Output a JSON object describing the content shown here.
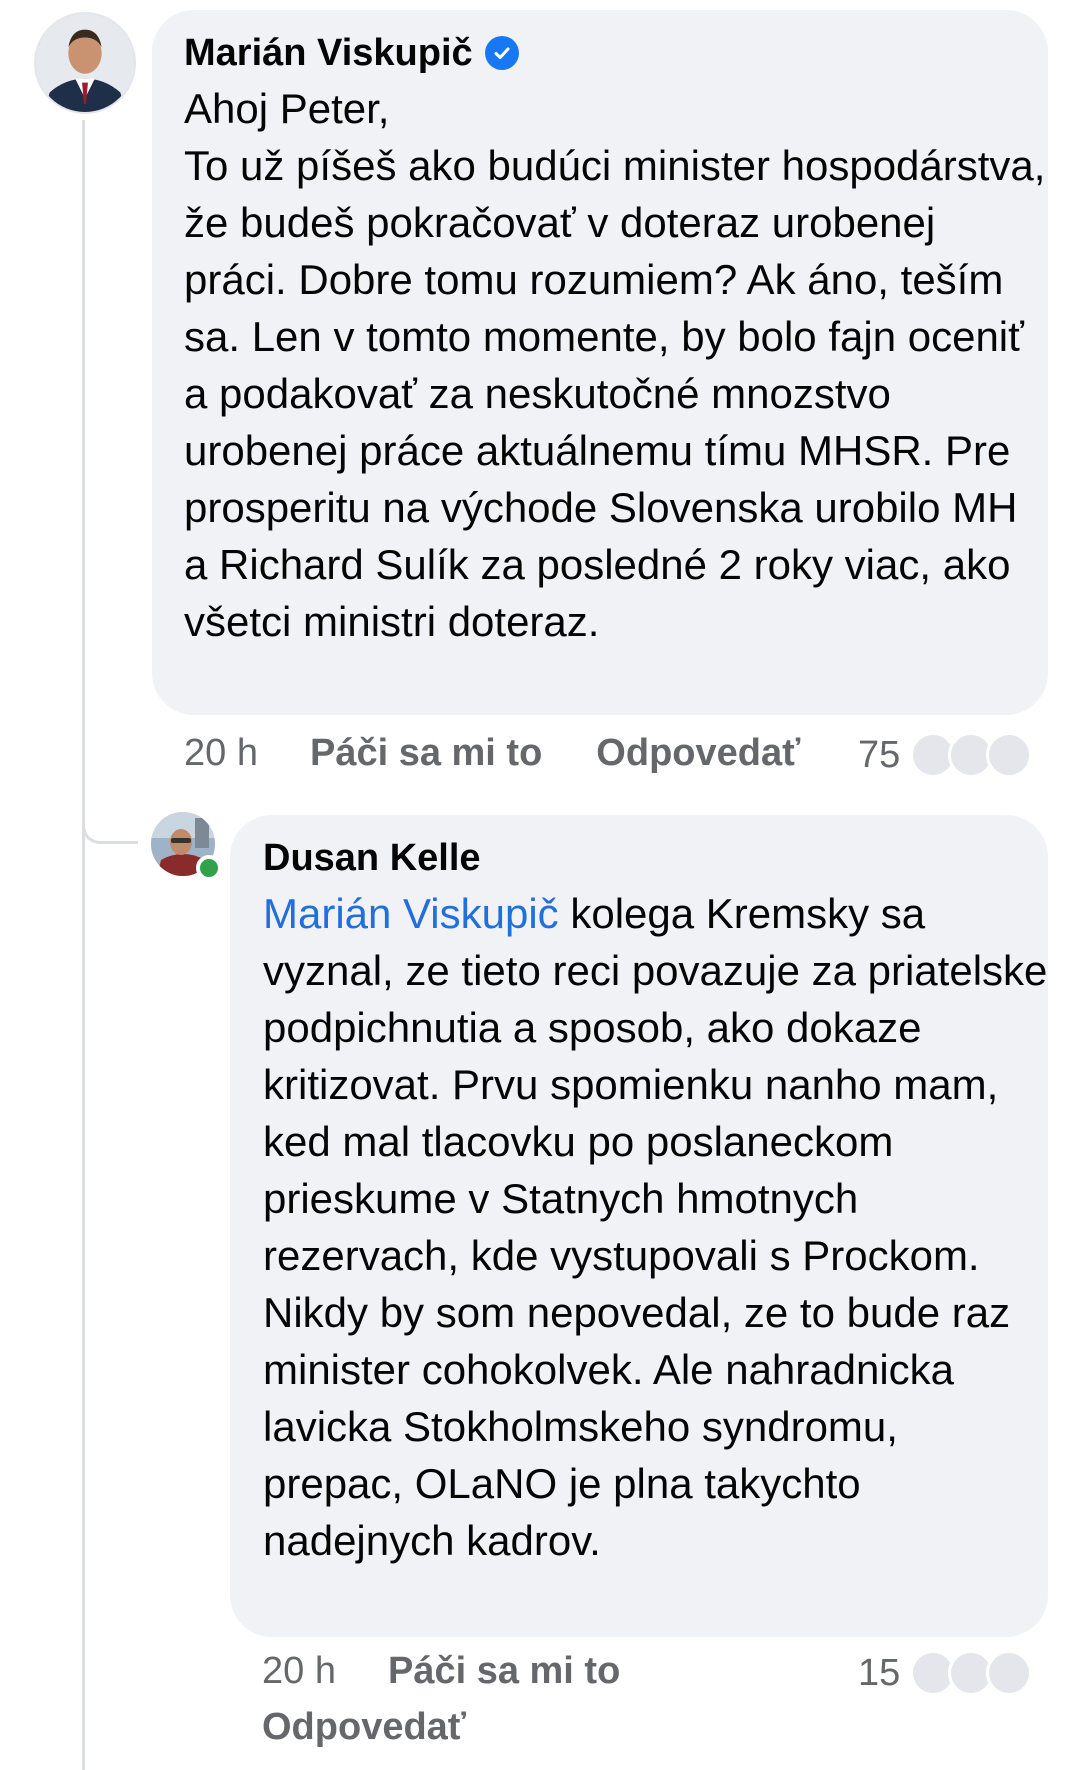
{
  "comment": {
    "author": "Marián Viskupič",
    "text": "Ahoj Peter,\nTo už píšeš ako budúci minister hospodárstva, že budeš pokračovať v doteraz urobenej práci. Dobre tomu rozumiem? Ak áno, teším sa. Len v tomto momente, by bolo fajn oceniť a podakovať za neskutočné mnozstvo urobenej práce aktuálnemu tímu MHSR. Pre prosperitu na východe Slovenska urobilo MH a Richard Sulík za posledné 2 roky viac, ako všetci ministri doteraz.",
    "time": "20 h",
    "like_label": "Páči sa mi to",
    "reply_label": "Odpovedať",
    "reaction_count": "75"
  },
  "reply": {
    "author": "Dusan Kelle",
    "mention": "Marián Viskupič",
    "text": " kolega Kremsky sa vyznal, ze tieto reci povazuje za priatelske podpichnutia a sposob, ako dokaze kritizovat. Prvu spomienku nanho mam, ked mal tlacovku po poslaneckom prieskume v Statnych hmotnych rezervach, kde vystupovali s Prockom. Nikdy by som nepovedal, ze to bude raz minister cohokolvek. Ale nahradnicka lavicka Stokholmskeho syndromu, prepac, OLaNO je plna takychto nadejnych kadrov.",
    "time": "20 h",
    "like_label": "Páči sa mi to",
    "reply_label": "Odpovedať",
    "reaction_count": "15"
  },
  "colors": {
    "bubble": "#f0f2f5",
    "mention": "#216fdb",
    "verified": "#1877f2",
    "online": "#31a24c",
    "meta": "#65676b"
  }
}
